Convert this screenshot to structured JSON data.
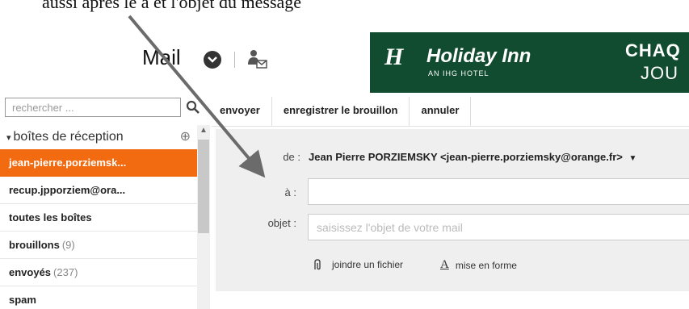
{
  "caption": "aussi après le à et l'objet du message",
  "header": {
    "title": "Mail",
    "icons": [
      "chevron-down-icon",
      "contact-icon"
    ]
  },
  "ad": {
    "logo_mark": "H",
    "brand": "Holiday Inn",
    "subtitle": "AN IHG HOTEL",
    "line1": "CHAQ",
    "line2": "JOU",
    "colors": {
      "background": "#124c30",
      "text": "#ffffff"
    }
  },
  "search": {
    "placeholder": "rechercher ...",
    "icon": "search-icon"
  },
  "toolbar": {
    "send": "envoyer",
    "save_draft": "enregistrer le brouillon",
    "cancel": "annuler"
  },
  "sidebar": {
    "header": "boîtes de réception",
    "items": [
      {
        "label": "jean-pierre.porziemsk...",
        "count": "",
        "active": true
      },
      {
        "label": "recup.jpporziem@ora...",
        "count": "",
        "active": false
      },
      {
        "label": "toutes les boîtes",
        "count": "",
        "active": false
      },
      {
        "label": "brouillons",
        "count": "(9)",
        "active": false
      },
      {
        "label": "envoyés",
        "count": "(237)",
        "active": false
      },
      {
        "label": "spam",
        "count": "",
        "active": false
      }
    ],
    "accent_color": "#f26b11"
  },
  "compose": {
    "from_label": "de :",
    "from_value": "Jean Pierre PORZIEMSKY <jean-pierre.porziemsky@orange.fr>",
    "to_label": "à :",
    "to_value": "",
    "subject_label": "objet :",
    "subject_placeholder": "saisissez l'objet de votre mail",
    "attach_label": "joindre un fichier",
    "format_label": "mise en forme",
    "format_glyph": "A"
  }
}
